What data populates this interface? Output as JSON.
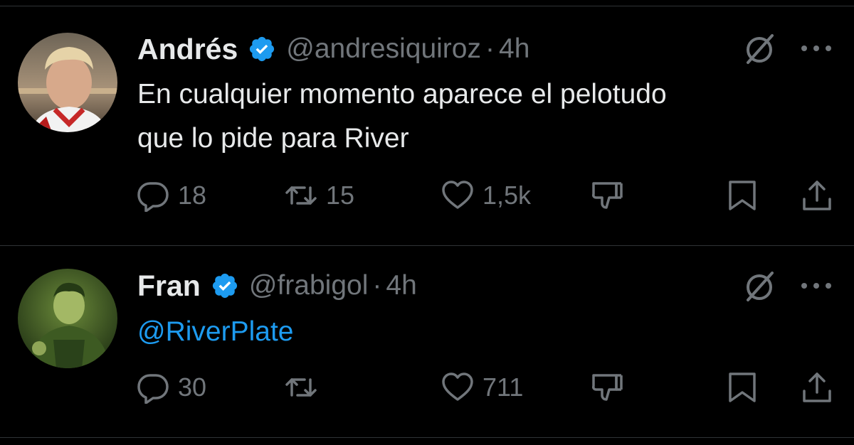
{
  "tweets": [
    {
      "name": "Andrés",
      "handle": "@andresiquiroz",
      "separator": "·",
      "time": "4h",
      "text_line1": "En cualquier momento aparece el pelotudo",
      "text_line2": "que lo pide para River",
      "replies": "18",
      "retweets": "15",
      "likes": "1,5k"
    },
    {
      "name": "Fran",
      "handle": "@frabigol",
      "separator": "·",
      "time": "4h",
      "mention": "@RiverPlate",
      "replies": "30",
      "retweets": "",
      "likes": "711"
    }
  ],
  "colors": {
    "background": "#000000",
    "text": "#e7e9ea",
    "muted": "#71767b",
    "accent": "#1d9bf0"
  },
  "icons": [
    "verified-badge-icon",
    "grok-icon",
    "more-icon",
    "reply-icon",
    "retweet-icon",
    "like-icon",
    "dislike-icon",
    "bookmark-icon",
    "share-icon"
  ]
}
